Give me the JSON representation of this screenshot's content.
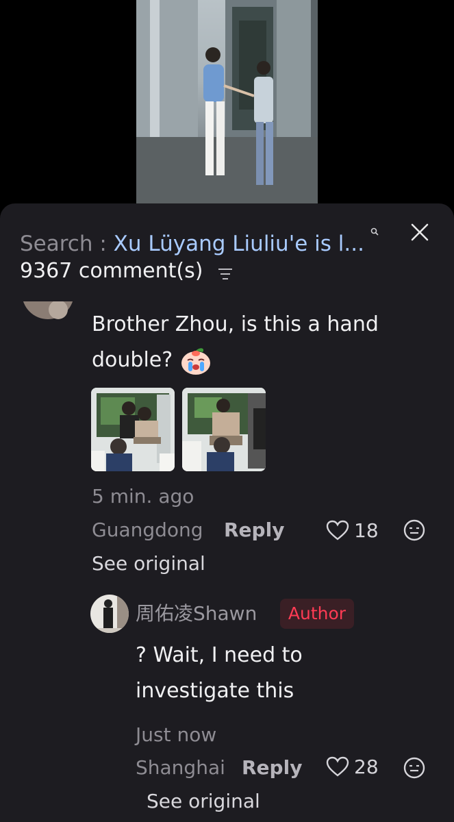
{
  "header": {
    "search_prefix": "Search : ",
    "search_query": "Xu Lüyang Liuliu'e is l...",
    "comment_count": "9367 comment(s)",
    "close_icon": "close-icon",
    "sort_icon": "sort-lines-icon",
    "search_icon": "search-icon"
  },
  "comment": {
    "text_line1": "Brother Zhou, is this a hand",
    "text_line2": "double?",
    "emoji": "crying-peach-emoji",
    "time": "5 min. ago",
    "location": "Guangdong",
    "reply_label": "Reply",
    "likes": "18",
    "see_original": "See original"
  },
  "reply": {
    "username": "周佑凌Shawn",
    "badge": "Author",
    "text_line1": "? Wait, I need to",
    "text_line2": "investigate this",
    "time": "Just now",
    "location": "Shanghai",
    "reply_label": "Reply",
    "likes": "28",
    "see_original": "See original"
  },
  "colors": {
    "sheet_bg": "#1d1c21",
    "author_red": "#ff3b54",
    "link_blue": "#a9cbff"
  }
}
